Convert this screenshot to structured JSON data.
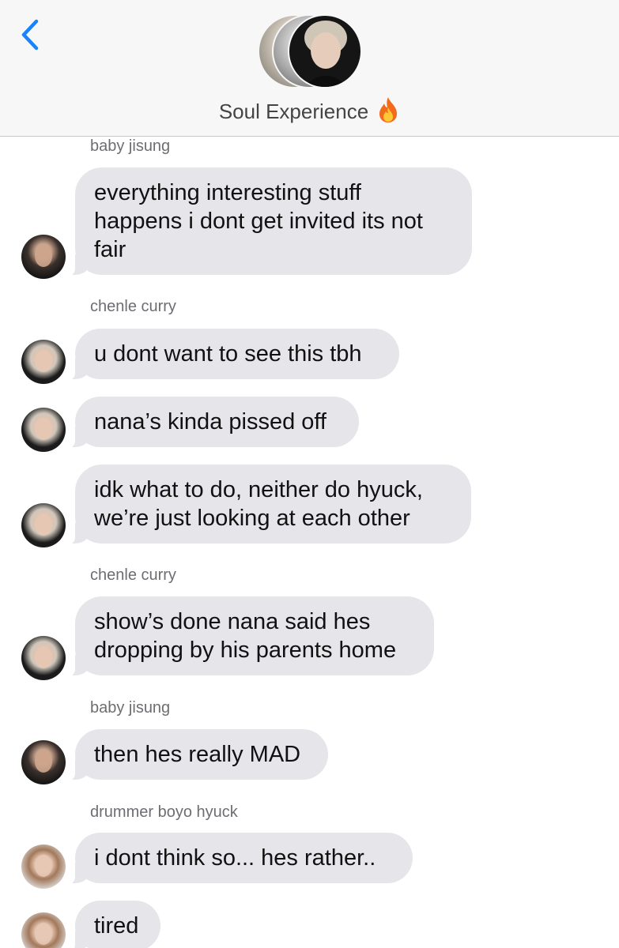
{
  "header": {
    "title": "Soul Experience",
    "title_emoji": "🔥",
    "back_icon": "chevron-left-icon",
    "accent_color": "#1a82fb"
  },
  "colors": {
    "incoming_bubble": "#e5e5ea",
    "sender_label": "#6d6d72",
    "header_bg": "#f7f7f7"
  },
  "messages": [
    {
      "sender": "baby jisung",
      "avatar": "avatar-jisung",
      "lines": [
        "everything interesting stuff",
        "happens i dont get invited its not",
        "fair"
      ]
    },
    {
      "sender": "chenle curry",
      "avatar": "avatar-chenle",
      "lines": [
        "u dont want to see this tbh"
      ]
    },
    {
      "sender": "",
      "avatar": "avatar-chenle",
      "lines": [
        "nana’s kinda pissed off"
      ]
    },
    {
      "sender": "",
      "avatar": "avatar-chenle",
      "lines": [
        "idk what to do, neither do hyuck,",
        "we’re just looking at each other"
      ]
    },
    {
      "sender": "chenle curry",
      "avatar": "avatar-chenle",
      "lines": [
        "show’s done nana said hes",
        "dropping by his parents home"
      ]
    },
    {
      "sender": "baby jisung",
      "avatar": "avatar-jisung",
      "lines": [
        "then hes really MAD"
      ]
    },
    {
      "sender": "drummer boyo hyuck",
      "avatar": "avatar-hyuck",
      "lines": [
        "i dont think so... hes rather.."
      ]
    },
    {
      "sender": "",
      "avatar": "avatar-hyuck",
      "lines": [
        "tired"
      ]
    }
  ]
}
